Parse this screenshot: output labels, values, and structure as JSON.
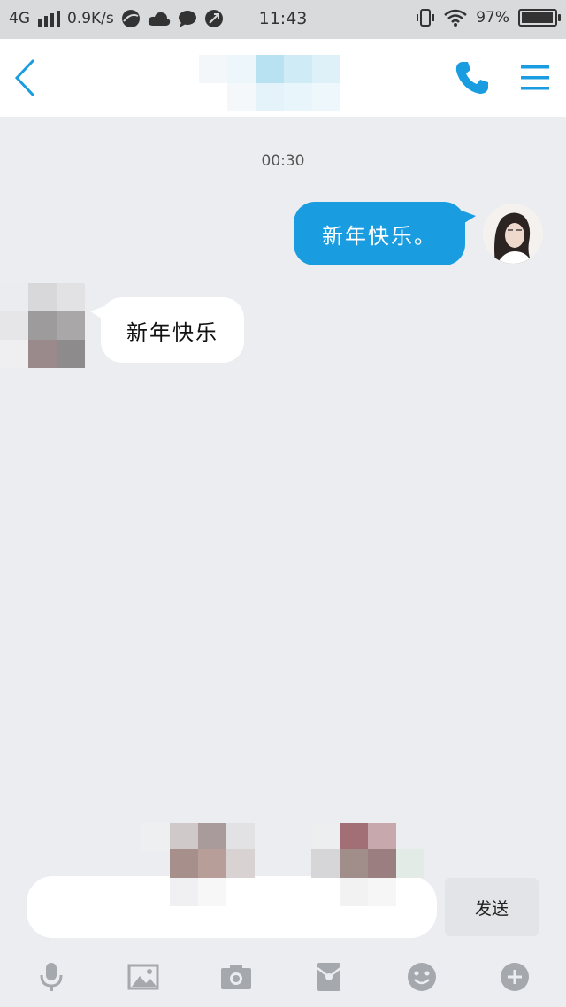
{
  "status_bar": {
    "network": "4G",
    "speed": "0.9K/s",
    "time": "11:43",
    "battery": "97%",
    "battery_level": 0.97
  },
  "header": {
    "back_icon": "chevron-left-icon",
    "call_icon": "phone-icon",
    "menu_icon": "menu-icon",
    "accent_color": "#1a9de0"
  },
  "chat": {
    "timestamp": "00:30",
    "messages": [
      {
        "direction": "outgoing",
        "text": "新年快乐。"
      },
      {
        "direction": "incoming",
        "text": "新年快乐"
      }
    ]
  },
  "input": {
    "send_label": "发送"
  },
  "toolbar": {
    "items": [
      "microphone-icon",
      "image-icon",
      "camera-icon",
      "red-packet-icon",
      "emoji-icon",
      "plus-icon"
    ]
  }
}
